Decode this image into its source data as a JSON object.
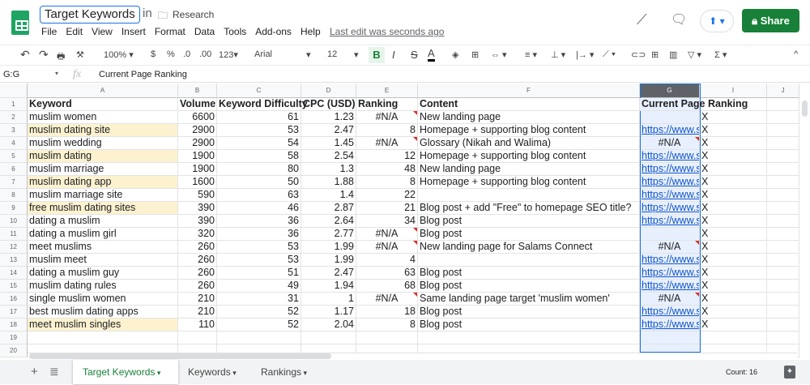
{
  "header": {
    "title": "Target Keywords",
    "in_label": "in",
    "folder": "Research",
    "last_edit": "Last edit was seconds ago",
    "share_label": "Share",
    "menu": [
      "File",
      "Edit",
      "View",
      "Insert",
      "Format",
      "Data",
      "Tools",
      "Add-ons",
      "Help"
    ]
  },
  "toolbar": {
    "zoom": "100%",
    "currency": "$",
    "percent": "%",
    "dec_less": ".0",
    "dec_more": ".00",
    "format": "123",
    "font": "Arial",
    "font_size": "12",
    "bold": "B",
    "italic": "I",
    "strike": "S",
    "text_color": "A",
    "sum": "Σ"
  },
  "formula_bar": {
    "name_box": "G:G",
    "fx": "fx",
    "content": "Current Page Ranking"
  },
  "columns": [
    "A",
    "B",
    "C",
    "D",
    "E",
    "F",
    "G",
    "I",
    "J"
  ],
  "headers": [
    "Keyword",
    "Volume",
    "Keyword Difficulty",
    "CPC (USD)",
    "Ranking",
    "Content",
    "Current Page Ranking",
    ""
  ],
  "rows": [
    [
      "muslim women",
      "6600",
      "61",
      "1.23",
      "#N/A",
      "New landing page",
      "",
      "X"
    ],
    [
      "muslim dating site",
      "2900",
      "53",
      "2.47",
      "8",
      "Homepage + supporting blog content",
      "https://www.s",
      "X"
    ],
    [
      "muslim wedding",
      "2900",
      "54",
      "1.45",
      "#N/A",
      "Glossary (Nikah and Walima)",
      "#N/A",
      "X"
    ],
    [
      "muslim dating",
      "1900",
      "58",
      "2.54",
      "12",
      "Homepage + supporting blog content",
      "https://www.s",
      "X"
    ],
    [
      "muslim marriage",
      "1900",
      "80",
      "1.3",
      "48",
      "New landing page",
      "https://www.s",
      "X"
    ],
    [
      "muslim dating app",
      "1600",
      "50",
      "1.88",
      "8",
      "Homepage + supporting blog content",
      "https://www.s",
      "X"
    ],
    [
      "muslim marriage site",
      "590",
      "63",
      "1.4",
      "22",
      "",
      "https://www.s",
      "X"
    ],
    [
      "free muslim dating sites",
      "390",
      "46",
      "2.87",
      "21",
      "Blog post + add \"Free\" to homepage SEO title?",
      "https://www.s",
      "X"
    ],
    [
      "dating a muslim",
      "390",
      "36",
      "2.64",
      "34",
      "Blog post",
      "https://www.s",
      "X"
    ],
    [
      "dating a muslim girl",
      "320",
      "36",
      "2.77",
      "#N/A",
      "Blog post",
      "",
      "X"
    ],
    [
      "meet muslims",
      "260",
      "53",
      "1.99",
      "#N/A",
      "New landing page for Salams Connect",
      "#N/A",
      "X"
    ],
    [
      "muslim meet",
      "260",
      "53",
      "1.99",
      "4",
      "",
      "https://www.s",
      "X"
    ],
    [
      "dating a muslim guy",
      "260",
      "51",
      "2.47",
      "63",
      "Blog post",
      "https://www.s",
      "X"
    ],
    [
      "muslim dating rules",
      "260",
      "49",
      "1.94",
      "68",
      "Blog post",
      "https://www.s",
      "X"
    ],
    [
      "single muslim women",
      "210",
      "31",
      "1",
      "#N/A",
      "Same landing page target 'muslim women'",
      "#N/A",
      "X"
    ],
    [
      "best muslim dating apps",
      "210",
      "52",
      "1.17",
      "18",
      "Blog post",
      "https://www.s",
      "X"
    ],
    [
      "meet muslim singles",
      "110",
      "52",
      "2.04",
      "8",
      "Blog post",
      "https://www.s",
      "X"
    ]
  ],
  "highlighted_rows": [
    3,
    5,
    7,
    9,
    18
  ],
  "highlight_color": "#fcf2d0",
  "sheets": [
    {
      "label": "Target Keywords",
      "active": true
    },
    {
      "label": "Keywords"
    },
    {
      "label": "Rankings"
    }
  ],
  "status": "Count: 16"
}
